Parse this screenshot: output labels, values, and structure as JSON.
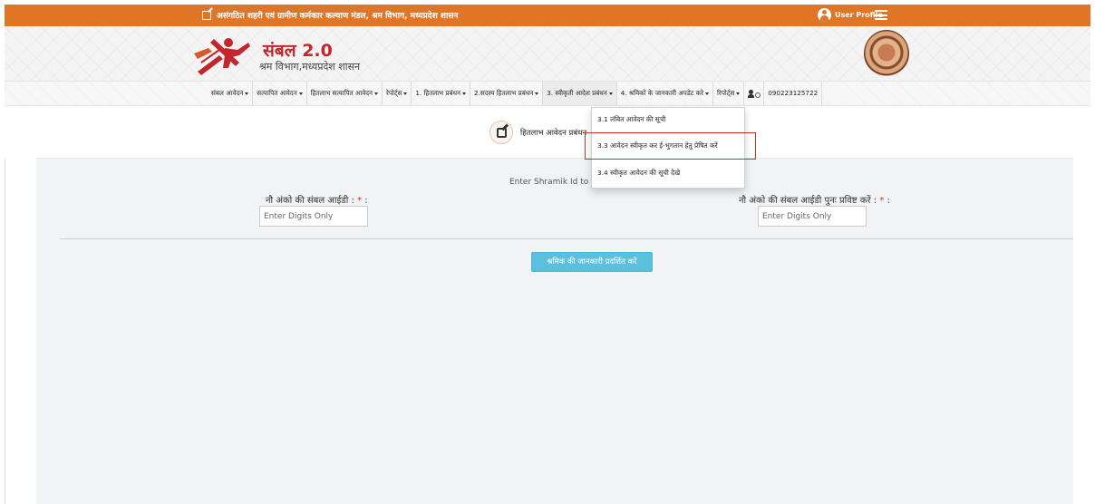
{
  "topbar": {
    "title": "असंगठित शहरी एवं ग्रामीण कर्मकार कल्याण मंडल, श्रम विभाग, मध्यप्रदेश शासन",
    "profile_label": "User Profile"
  },
  "header": {
    "brand": "संबल 2.0",
    "subtitle": "श्रम विभाग,मध्यप्रदेश शासन"
  },
  "nav": {
    "items": [
      {
        "label": "संबल आवेदन"
      },
      {
        "label": "सत्यापित आवेदन"
      },
      {
        "label": "हितलाभ सत्यापित आवेदन"
      },
      {
        "label": "रेपोर्ट्स"
      },
      {
        "label": "1. हितलाभ प्रबंधन"
      },
      {
        "label": "2.सदस्य हितलाभ प्रबंधन"
      },
      {
        "label": "3. स्वीकृती आदेश प्रबंधन"
      },
      {
        "label": "4. श्रमिकों के जानकारी अपडेट करे"
      },
      {
        "label": "रिपोर्ट्स"
      }
    ],
    "user_id": "090223125722"
  },
  "dropdown": {
    "items": [
      {
        "label": "3.1 लंबित आवेदन की सूची"
      },
      {
        "label": "3.3 आवेदन स्वीकृत कर ई-भुगतान हेतु प्रेषित करें"
      },
      {
        "label": "3.4 स्वीकृत आवेदन की सूची देखे"
      }
    ]
  },
  "section": {
    "title": "हितलाभ आवेदन प्रबंधन"
  },
  "form": {
    "instruction": "Enter Shramik Id to Se",
    "field1_label": "नौ अंको की संबल आईडी :",
    "field2_label": "नौ अंको की संबल आईडी पुनः प्रविष्ट करें :",
    "required_mark": "*",
    "label_colon": ":",
    "field1_placeholder": "Enter Digits Only",
    "field2_placeholder": "Enter Digits Only",
    "submit_label": "श्रमिक की जानकारी प्रदर्शित करें"
  },
  "colors": {
    "topbar": "#e07525",
    "brand": "#c2272d",
    "button": "#5bc0de",
    "highlight": "#d42b2b"
  }
}
